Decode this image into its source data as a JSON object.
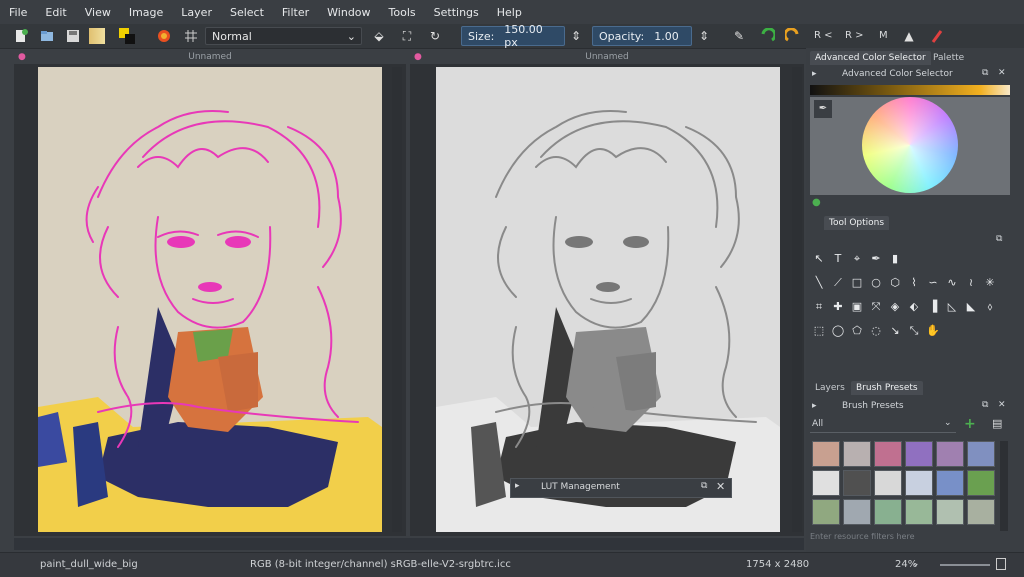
{
  "menu": [
    "File",
    "Edit",
    "View",
    "Image",
    "Layer",
    "Select",
    "Filter",
    "Window",
    "Tools",
    "Settings",
    "Help"
  ],
  "toolbar": {
    "blend_mode": "Normal",
    "size_label": "Size:",
    "size_value": "150.00 px",
    "opacity_label": "Opacity:",
    "opacity_value": "1.00",
    "mirror_r_left": "R <",
    "mirror_r_right": "R >",
    "mirror_m": "M"
  },
  "canvases": {
    "left_title": "Unnamed",
    "right_title": "Unnamed"
  },
  "lut_popup": {
    "title": "LUT Management"
  },
  "dock": {
    "tabs_top": [
      "Advanced Color Selector",
      "Palette"
    ],
    "color_selector_title": "Advanced Color Selector",
    "tool_options_tab": "Tool Options",
    "tabs_bottom": [
      "Layers",
      "Brush Presets"
    ],
    "brush_presets_title": "Brush Presets",
    "preset_filter": "All",
    "tag_placeholder": "Enter resource filters here"
  },
  "status": {
    "preset_name": "paint_dull_wide_big",
    "color_space": "RGB (8-bit integer/channel)  sRGB-elle-V2-srgbtrc.icc",
    "dimensions": "1754 x 2480",
    "zoom": "24%"
  },
  "colors": {
    "accent": "#2f4a66",
    "pink_sketch": "#e838b8",
    "navy": "#2c2f66",
    "yellow": "#f2cf4a"
  }
}
